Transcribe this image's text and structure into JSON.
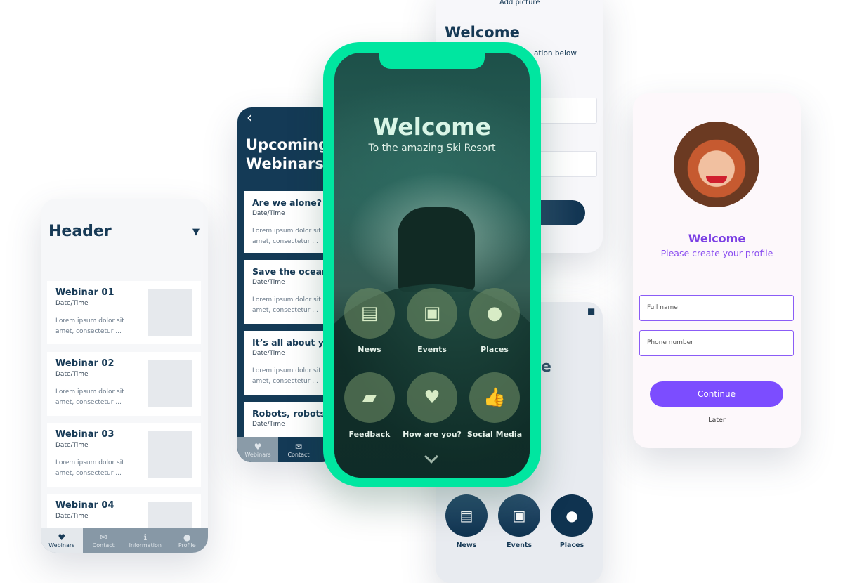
{
  "left_phone": {
    "header": "Header",
    "filter_icon": "filter-icon",
    "cards": [
      {
        "title": "Webinar 01",
        "date": "Date/Time",
        "text": "Lorem ipsum dolor sit amet, consectetur ..."
      },
      {
        "title": "Webinar 02",
        "date": "Date/Time",
        "text": "Lorem ipsum dolor sit amet, consectetur ..."
      },
      {
        "title": "Webinar 03",
        "date": "Date/Time",
        "text": "Lorem ipsum dolor sit amet, consectetur ..."
      },
      {
        "title": "Webinar 04",
        "date": "Date/Time",
        "text": ""
      }
    ],
    "tabs": [
      {
        "label": "Webinars",
        "icon": "heart-icon"
      },
      {
        "label": "Contact",
        "icon": "mail-icon"
      },
      {
        "label": "Information",
        "icon": "info-icon"
      },
      {
        "label": "Profile",
        "icon": "user-icon"
      }
    ]
  },
  "webinars_phone": {
    "back": "‹",
    "title_line1": "Upcoming",
    "title_line2": "Webinars",
    "cards": [
      {
        "title": "Are we alone?",
        "date": "Date/Time",
        "text": "Lorem ipsum dolor sit amet, consectetur ..."
      },
      {
        "title": "Save the oceans",
        "date": "Date/Time",
        "text": "Lorem ipsum dolor sit amet, consectetur ..."
      },
      {
        "title": "It’s all about yo",
        "date": "Date/Time",
        "text": "Lorem ipsum dolor sit amet, consectetur ..."
      },
      {
        "title": "Robots, robots",
        "date": "Date/Time",
        "text": ""
      }
    ],
    "tabs": [
      {
        "label": "Webinars"
      },
      {
        "label": "Contact"
      }
    ]
  },
  "form_phone": {
    "add_picture": "Add picture",
    "title": "Welcome",
    "subtitle": "ation below"
  },
  "bottom_phone": {
    "title_fragment": "e",
    "items": [
      {
        "label": "News"
      },
      {
        "label": "Events"
      },
      {
        "label": "Places"
      }
    ]
  },
  "profile_phone": {
    "title": "Welcome",
    "subtitle": "Please create your profile",
    "full_name_placeholder": "Full name",
    "phone_placeholder": "Phone number",
    "continue": "Continue",
    "later": "Later",
    "accent": "#7c4dff"
  },
  "main_phone": {
    "title": "Welcome",
    "subtitle": "To the amazing Ski Resort",
    "frame_color": "#00e6a0",
    "items": [
      {
        "label": "News",
        "icon": "newspaper-icon"
      },
      {
        "label": "Events",
        "icon": "calendar-icon"
      },
      {
        "label": "Places",
        "icon": "map-pin-icon"
      },
      {
        "label": "Feedback",
        "icon": "chat-icon"
      },
      {
        "label": "How are you?",
        "icon": "heart-icon"
      },
      {
        "label": "Social Media",
        "icon": "thumbs-up-icon"
      }
    ]
  }
}
